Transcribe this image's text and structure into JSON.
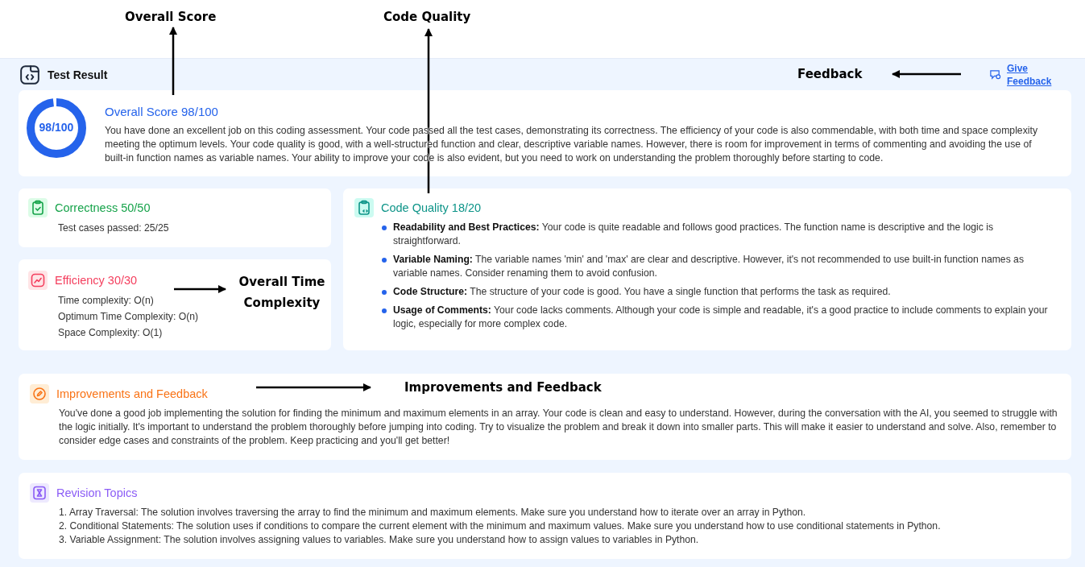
{
  "annotations": [
    {
      "label": "Overall Score"
    },
    {
      "label": "Code Quality"
    },
    {
      "label": "Feedback"
    },
    {
      "label": "Overall Time Complexity"
    },
    {
      "label": "Improvements and Feedback"
    }
  ],
  "header": {
    "title": "Test Result",
    "feedback_link": "Give Feedback"
  },
  "overall": {
    "title": "Overall Score 98/100",
    "score": "98/100",
    "level": 0.98,
    "summary": "You have done an excellent job on this coding assessment. Your code passed all the test cases, demonstrating its correctness. The efficiency of your code is also commendable, with both time and space complexity meeting the optimum levels. Your code quality is good, with a well-structured function and clear, descriptive variable names. However, there is room for improvement in terms of commenting and avoiding the use of built-in function names as variable names. Your ability to improve your code is also evident, but you need to work on understanding the problem thoroughly before starting to code."
  },
  "correctness": {
    "title": "Correctness 50/50",
    "lines": [
      "Test cases passed: 25/25"
    ]
  },
  "efficiency": {
    "title": "Efficiency 30/30",
    "lines": [
      "Time complexity: O(n)",
      "Optimum Time Complexity: O(n)",
      "Space Complexity: O(1)"
    ]
  },
  "code_quality": {
    "title": "Code Quality 18/20",
    "points": [
      {
        "text": "**Readability and Best Practices:** Your code is quite readable and follows good practices. The function name is descriptive and the logic is straightforward."
      },
      {
        "text": "**Variable Naming:** The variable names 'min' and 'max' are clear and descriptive. However, it's not recommended to use built-in function names as variable names. Consider renaming them to avoid confusion."
      },
      {
        "text": "**Code Structure:** The structure of your code is good. You have a single function that performs the task as required."
      },
      {
        "text": "**Usage of Comments:** Your code lacks comments. Although your code is simple and readable, it's a good practice to include comments to explain your logic, especially for more complex code."
      }
    ]
  },
  "improvements": {
    "title": "Improvements and Feedback",
    "text": "You've done a good job implementing the solution for finding the minimum and maximum elements in an array. Your code is clean and easy to understand. However, during the conversation with the AI, you seemed to struggle with the logic initially. It's important to understand the problem thoroughly before jumping into coding. Try to visualize the problem and break it down into smaller parts. This will make it easier to understand and solve. Also, remember to consider edge cases and constraints of the problem. Keep practicing and you'll get better!"
  },
  "revision": {
    "title": "Revision Topics",
    "items": [
      "1. Array Traversal: The solution involves traversing the array to find the minimum and maximum elements. Make sure you understand how to iterate over an array in Python.",
      "2. Conditional Statements: The solution uses if conditions to compare the current element with the minimum and maximum values. Make sure you understand how to use conditional statements in Python.",
      "3. Variable Assignment: The solution involves assigning values to variables. Make sure you understand how to assign values to variables in Python."
    ]
  }
}
